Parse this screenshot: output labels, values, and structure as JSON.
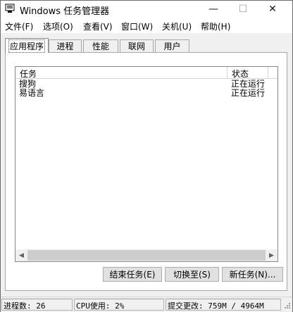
{
  "window": {
    "title": "Windows 任务管理器"
  },
  "title_controls": {
    "minimize": "—",
    "maximize": "☐",
    "close": "✕"
  },
  "menu": [
    {
      "label": "文件(F)"
    },
    {
      "label": "选项(O)"
    },
    {
      "label": "查看(V)"
    },
    {
      "label": "窗口(W)"
    },
    {
      "label": "关机(U)"
    },
    {
      "label": "帮助(H)"
    }
  ],
  "tabs": [
    {
      "label": "应用程序",
      "active": true
    },
    {
      "label": "进程",
      "active": false
    },
    {
      "label": "性能",
      "active": false
    },
    {
      "label": "联网",
      "active": false
    },
    {
      "label": "用户",
      "active": false
    }
  ],
  "task_list": {
    "columns": [
      "任务",
      "状态"
    ],
    "rows": [
      {
        "name": "搜狗",
        "status": "正在运行"
      },
      {
        "name": "易语言",
        "status": "正在运行"
      }
    ]
  },
  "buttons": {
    "end_task": "结束任务(E)",
    "switch_to": "切换至(S)",
    "new_task": "新任务(N)..."
  },
  "statusbar": {
    "processes": "进程数: 26",
    "cpu": "CPU使用: 2%",
    "commit": "提交更改: 759M / 4964M"
  },
  "colors": {
    "accent": "#cdcdcd",
    "window_bg": "#f0f0f0"
  }
}
